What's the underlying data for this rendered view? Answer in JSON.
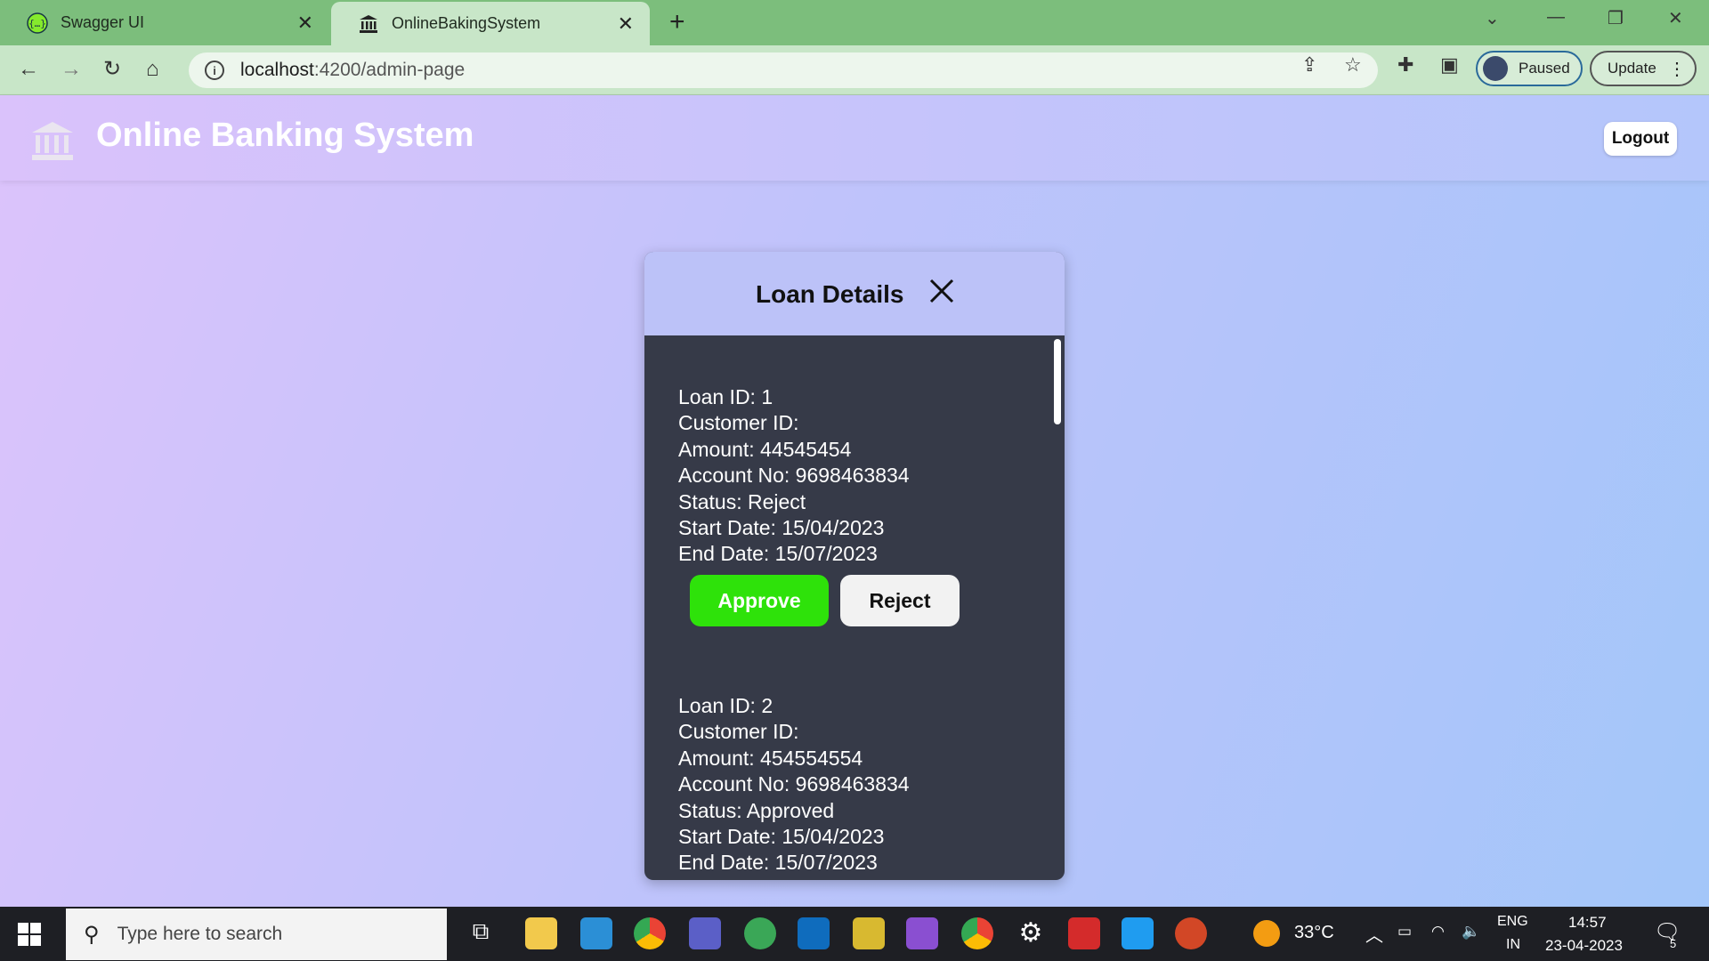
{
  "browser": {
    "tabs": [
      {
        "label": "Swagger UI",
        "active": false
      },
      {
        "label": "OnlineBakingSystem",
        "active": true
      }
    ],
    "url_host": "localhost",
    "url_path": ":4200/admin-page",
    "profile_label": "Paused",
    "update_label": "Update"
  },
  "app": {
    "title": "Online Banking System",
    "logout_label": "Logout"
  },
  "modal": {
    "title": "Loan Details",
    "loans": [
      {
        "loan_id": "Loan ID: 1",
        "customer_id": "Customer ID:",
        "amount": "Amount: 44545454",
        "account_no": "Account No: 9698463834",
        "status": "Status: Reject",
        "start_date": "Start Date: 15/04/2023",
        "end_date": "End Date: 15/07/2023",
        "approve_label": "Approve",
        "reject_label": "Reject"
      },
      {
        "loan_id": "Loan ID: 2",
        "customer_id": "Customer ID:",
        "amount": "Amount: 454554554",
        "account_no": "Account No: 9698463834",
        "status": "Status: Approved",
        "start_date": "Start Date: 15/04/2023",
        "end_date": "End Date: 15/07/2023"
      }
    ]
  },
  "taskbar": {
    "search_placeholder": "Type here to search",
    "weather": "33°C",
    "language_top": "ENG",
    "language_bottom": "IN",
    "time": "14:57",
    "date": "23-04-2023",
    "notification_count": "5"
  },
  "colors": {
    "approve": "#2ee20a",
    "tabstrip": "#7cbe7c",
    "modal_body": "#363a48",
    "modal_header": "#bcc2f8"
  }
}
